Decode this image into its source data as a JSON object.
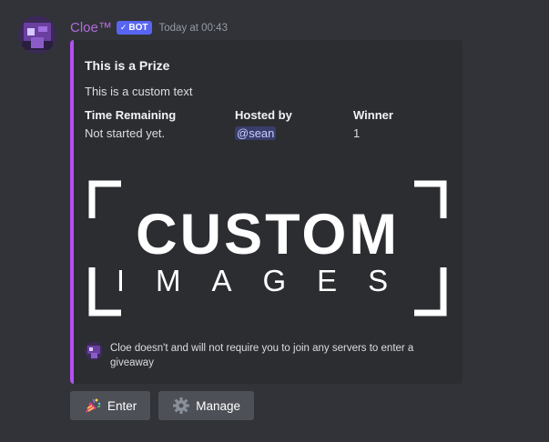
{
  "message": {
    "author": "Cloe™",
    "bot_tag": "BOT",
    "bot_check_icon": "checkmark-icon",
    "timestamp": "Today at 00:43"
  },
  "embed": {
    "accent_color": "#b450f0",
    "title": "This is a Prize",
    "description": "This is a custom text",
    "fields": [
      {
        "name": "Time Remaining",
        "value": "Not started yet."
      },
      {
        "name": "Hosted by",
        "value": "@sean"
      },
      {
        "name": "Winner",
        "value": "1"
      }
    ],
    "image": {
      "line1": "CUSTOM",
      "line2": "IMAGES"
    },
    "footer": {
      "text": "Cloe doesn't and will not require you to join any servers to enter a giveaway"
    }
  },
  "buttons": [
    {
      "label": "Enter",
      "icon": "party-popper-icon"
    },
    {
      "label": "Manage",
      "icon": "gear-icon"
    }
  ]
}
